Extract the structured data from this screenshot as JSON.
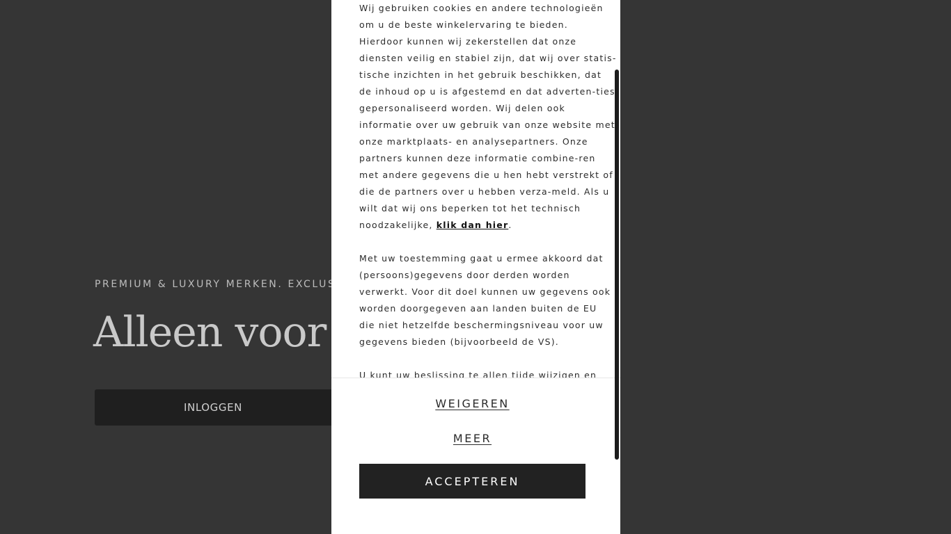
{
  "hero": {
    "eyebrow": "PREMIUM & LUXURY MERKEN. EXCLUSIEV",
    "title": "Alleen voor le",
    "login_label": "INLOGGEN"
  },
  "cookie_modal": {
    "paragraph1_lines": [
      "Wij gebruiken cookies en andere technologieën",
      "om u de beste winkelervaring te bieden.",
      "Hierdoor kunnen wij zekerstellen dat onze",
      "diensten veilig en stabiel zijn, dat wij over statis-",
      "tische inzichten in het gebruik beschikken, dat",
      "de inhoud op u is afgestemd en dat adverten-ties",
      "gepersonaliseerd worden. Wij delen ook",
      "informatie over uw gebruik van onze website met",
      "onze marktplaats- en analysepartners. Onze",
      "partners kunnen deze informatie combine-ren",
      "met andere gegevens die u hen hebt verstrekt of",
      "die de partners over u hebben verza-meld. Als u",
      "wilt dat wij ons beperken tot het technisch"
    ],
    "paragraph1_last_prefix": "noodzakelijke, ",
    "paragraph1_link": "klik dan hier",
    "paragraph1_last_suffix": ".",
    "paragraph2_lines": [
      "Met uw toestemming gaat u ermee akkoord dat",
      "(persoons)gegevens door derden worden",
      "verwerkt. Voor dit doel kunnen uw gegevens ook",
      "worden doorgegeven aan landen buiten de EU",
      "die niet hetzelfde beschermingsniveau voor uw",
      "gegevens bieden (bijvoorbeeld de VS)."
    ],
    "paragraph3_lines": [
      "U kunt uw beslissing te allen tijde wijzigen en"
    ],
    "refuse_label": "WEIGEREN",
    "more_label": "MEER",
    "accept_label": "ACCEPTEREN"
  },
  "colors": {
    "backdrop": "#353535",
    "modal_bg": "#ffffff",
    "accept_bg": "#222222",
    "login_bg": "#1f1f1f"
  }
}
